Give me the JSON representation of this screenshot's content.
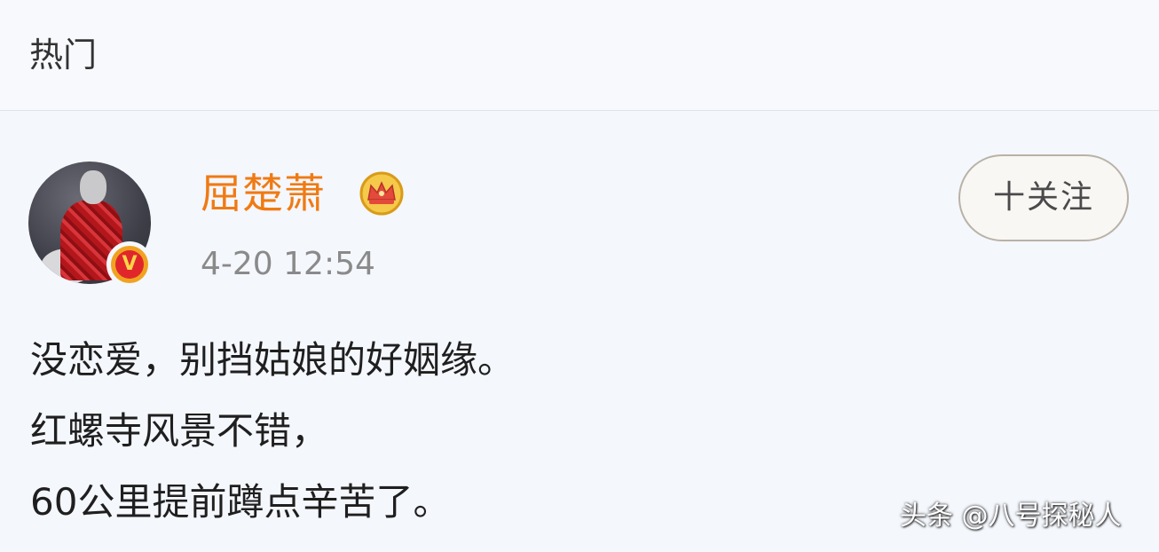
{
  "header": {
    "title": "热门"
  },
  "post": {
    "author": {
      "name": "屈楚萧",
      "avatar_icon": "user-avatar",
      "verified_icon": "verified-v-badge-icon",
      "verified_symbol": "V",
      "vip_icon": "crown-icon"
    },
    "timestamp": "4-20 12:54",
    "follow_label": "十关注",
    "content_lines": [
      "没恋爱，别挡姑娘的好姻缘。",
      "红螺寺风景不错，",
      "60公里提前蹲点辛苦了。"
    ]
  },
  "watermark": "头条 @八号探秘人",
  "colors": {
    "username": "#f07a13",
    "timestamp": "#8a8a8a",
    "text": "#1f1f1f",
    "badge": "#e0262b"
  }
}
